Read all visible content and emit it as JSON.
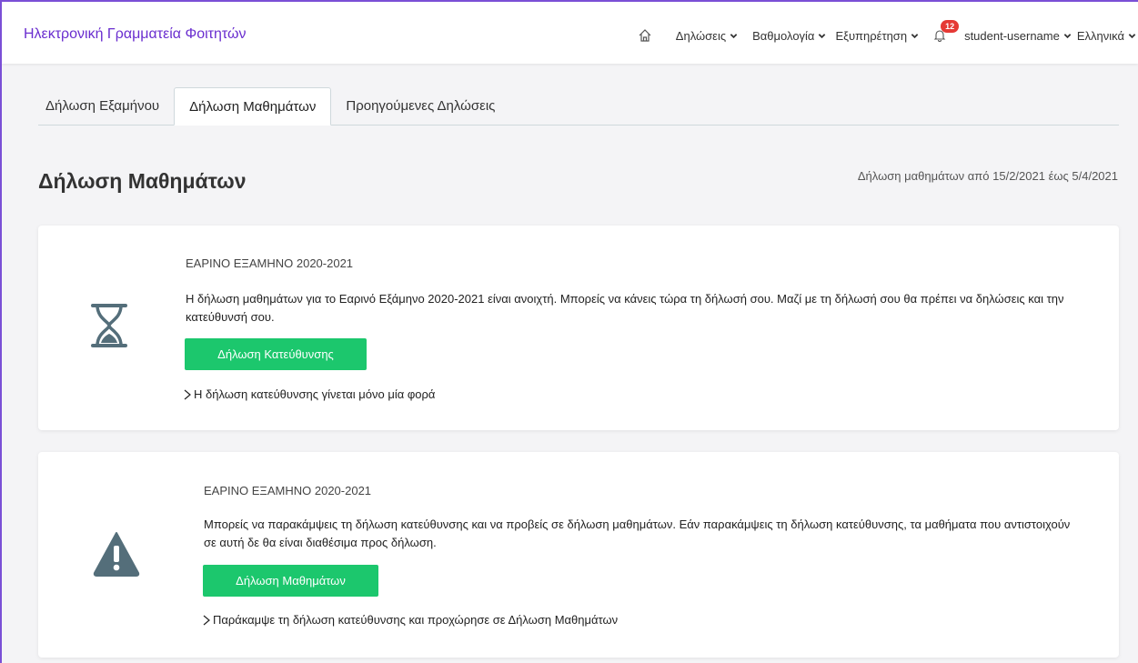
{
  "navbar": {
    "brand": "Ηλεκτρονική Γραμματεία Φοιτητών",
    "menu": {
      "declarations": "Δηλώσεις",
      "grades": "Βαθμολογία",
      "service": "Εξυπηρέτηση",
      "notifications_count": "12",
      "username": "student-username",
      "language": "Ελληνικά"
    }
  },
  "tabs": [
    {
      "label": "Δήλωση Εξαμήνου"
    },
    {
      "label": "Δήλωση Μαθημάτων"
    },
    {
      "label": "Προηγούμενες Δηλώσεις"
    }
  ],
  "page": {
    "title": "Δήλωση Μαθημάτων",
    "period": "Δήλωση μαθημάτων από 15/2/2021 έως 5/4/2021"
  },
  "cards": [
    {
      "semester": "ΕΑΡΙΝΟ ΕΞΑΜΗΝΟ 2020-2021",
      "description": "Η δήλωση μαθημάτων για το Εαρινό Εξάμηνο 2020-2021 είναι ανοιχτή. Μπορείς να κάνεις τώρα τη δήλωσή σου. Μαζί με τη δήλωσή σου θα πρέπει να δηλώσεις και την κατεύθυνσή σου.",
      "button": "Δήλωση Κατεύθυνσης",
      "link": "Η δήλωση κατεύθυνσης γίνεται μόνο μία φορά",
      "icon": "hourglass-icon"
    },
    {
      "semester": "ΕΑΡΙΝΟ ΕΞΑΜΗΝΟ 2020-2021",
      "description": "Μπορείς να παρακάμψεις τη δήλωση κατεύθυνσης και να προβείς σε δήλωση μαθημάτων. Εάν παρακάμψεις τη δήλωση κατεύθυνσης, τα μαθήματα που αντιστοιχούν σε αυτή δε θα είναι διαθέσιμα προς δήλωση.",
      "button": "Δήλωση Μαθημάτων",
      "link": "Παράκαμψε τη δήλωση κατεύθυνσης και προχώρησε σε Δήλωση Μαθημάτων",
      "icon": "warning-icon"
    }
  ],
  "colors": {
    "brand": "#6a2ecf",
    "button": "#1cc76d",
    "icon": "#546e7a",
    "badge": "#e53935"
  }
}
